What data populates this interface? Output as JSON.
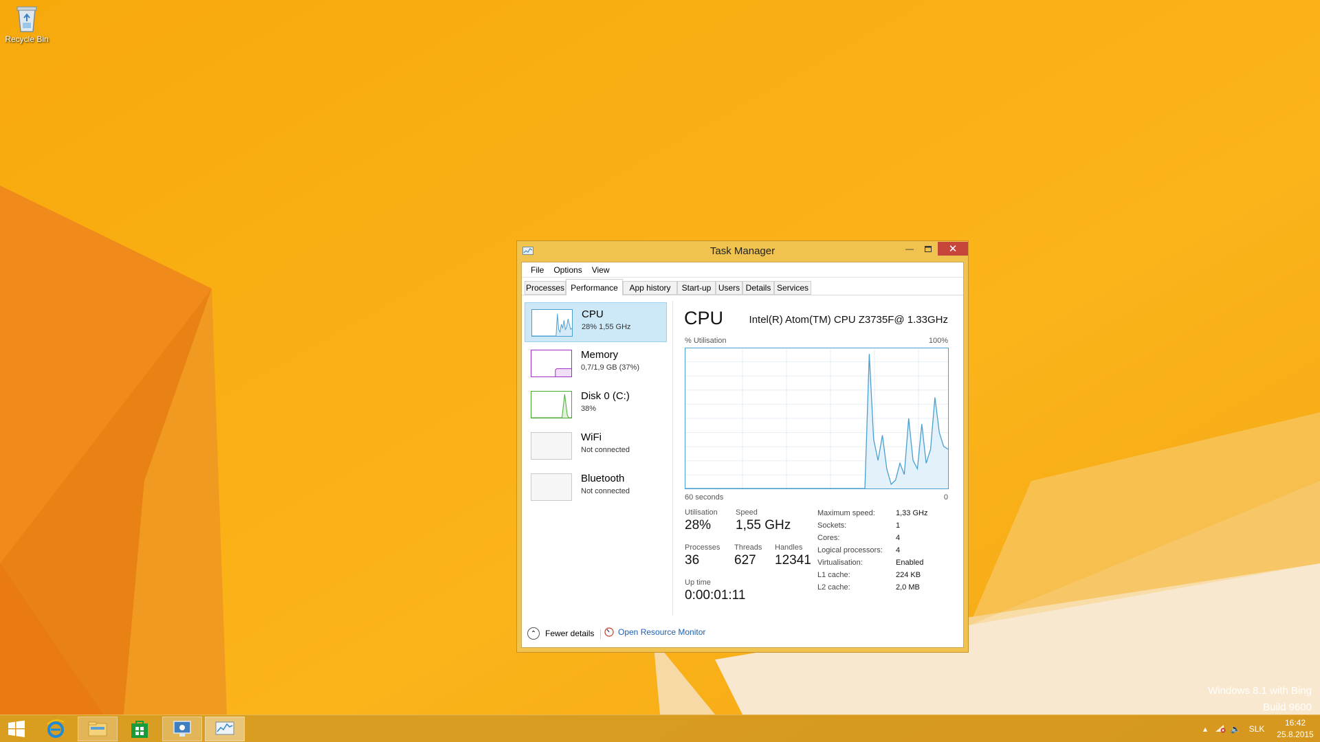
{
  "desktop": {
    "recycle_bin_label": "Recycle Bin",
    "watermark": {
      "line1": "Windows 8.1 with Bing",
      "line2": "Build 9600"
    }
  },
  "window": {
    "title": "Task Manager",
    "menu": [
      "File",
      "Options",
      "View"
    ],
    "tabs": [
      "Processes",
      "Performance",
      "App history",
      "Start-up",
      "Users",
      "Details",
      "Services"
    ],
    "selected_tab": "Performance"
  },
  "resources": [
    {
      "name": "CPU",
      "sub": "28%  1,55 GHz",
      "selected": true
    },
    {
      "name": "Memory",
      "sub": "0,7/1,9 GB (37%)",
      "selected": false
    },
    {
      "name": "Disk 0 (C:)",
      "sub": "38%",
      "selected": false
    },
    {
      "name": "WiFi",
      "sub": "Not connected",
      "selected": false
    },
    {
      "name": "Bluetooth",
      "sub": "Not connected",
      "selected": false
    }
  ],
  "detail": {
    "title": "CPU",
    "model": "Intel(R) Atom(TM) CPU  Z3735F@ 1.33GHz",
    "graph_label_left": "% Utilisation",
    "graph_label_right": "100%",
    "axis_left": "60 seconds",
    "axis_right": "0",
    "stats": {
      "utilisation_label": "Utilisation",
      "utilisation_value": "28%",
      "speed_label": "Speed",
      "speed_value": "1,55 GHz",
      "processes_label": "Processes",
      "processes_value": "36",
      "threads_label": "Threads",
      "threads_value": "627",
      "handles_label": "Handles",
      "handles_value": "12341",
      "uptime_label": "Up time",
      "uptime_value": "0:00:01:11"
    },
    "specs": [
      {
        "label": "Maximum speed:",
        "value": "1,33 GHz"
      },
      {
        "label": "Sockets:",
        "value": "1"
      },
      {
        "label": "Cores:",
        "value": "4"
      },
      {
        "label": "Logical processors:",
        "value": "4"
      },
      {
        "label": "Virtualisation:",
        "value": "Enabled"
      },
      {
        "label": "L1 cache:",
        "value": "224 KB"
      },
      {
        "label": "L2 cache:",
        "value": "2,0 MB"
      }
    ],
    "cpu_history": [
      0,
      0,
      0,
      0,
      0,
      0,
      0,
      0,
      0,
      0,
      0,
      0,
      0,
      0,
      0,
      0,
      0,
      0,
      0,
      0,
      0,
      0,
      0,
      0,
      0,
      0,
      0,
      0,
      0,
      0,
      0,
      0,
      0,
      0,
      0,
      0,
      0,
      0,
      0,
      0,
      0,
      0,
      96,
      35,
      20,
      38,
      14,
      3,
      6,
      18,
      10,
      50,
      20,
      14,
      46,
      18,
      28,
      65,
      40,
      30,
      28
    ]
  },
  "footer": {
    "fewer_details": "Fewer details",
    "open_resource_monitor": "Open Resource Monitor"
  },
  "taskbar": {
    "language": "SLK",
    "time": "16:42",
    "date": "25.8.2015"
  },
  "colors": {
    "accent_cpu": "#4a9fd0",
    "memory": "#9b2ec4",
    "disk": "#4aa832",
    "close_button": "#c7463c"
  }
}
